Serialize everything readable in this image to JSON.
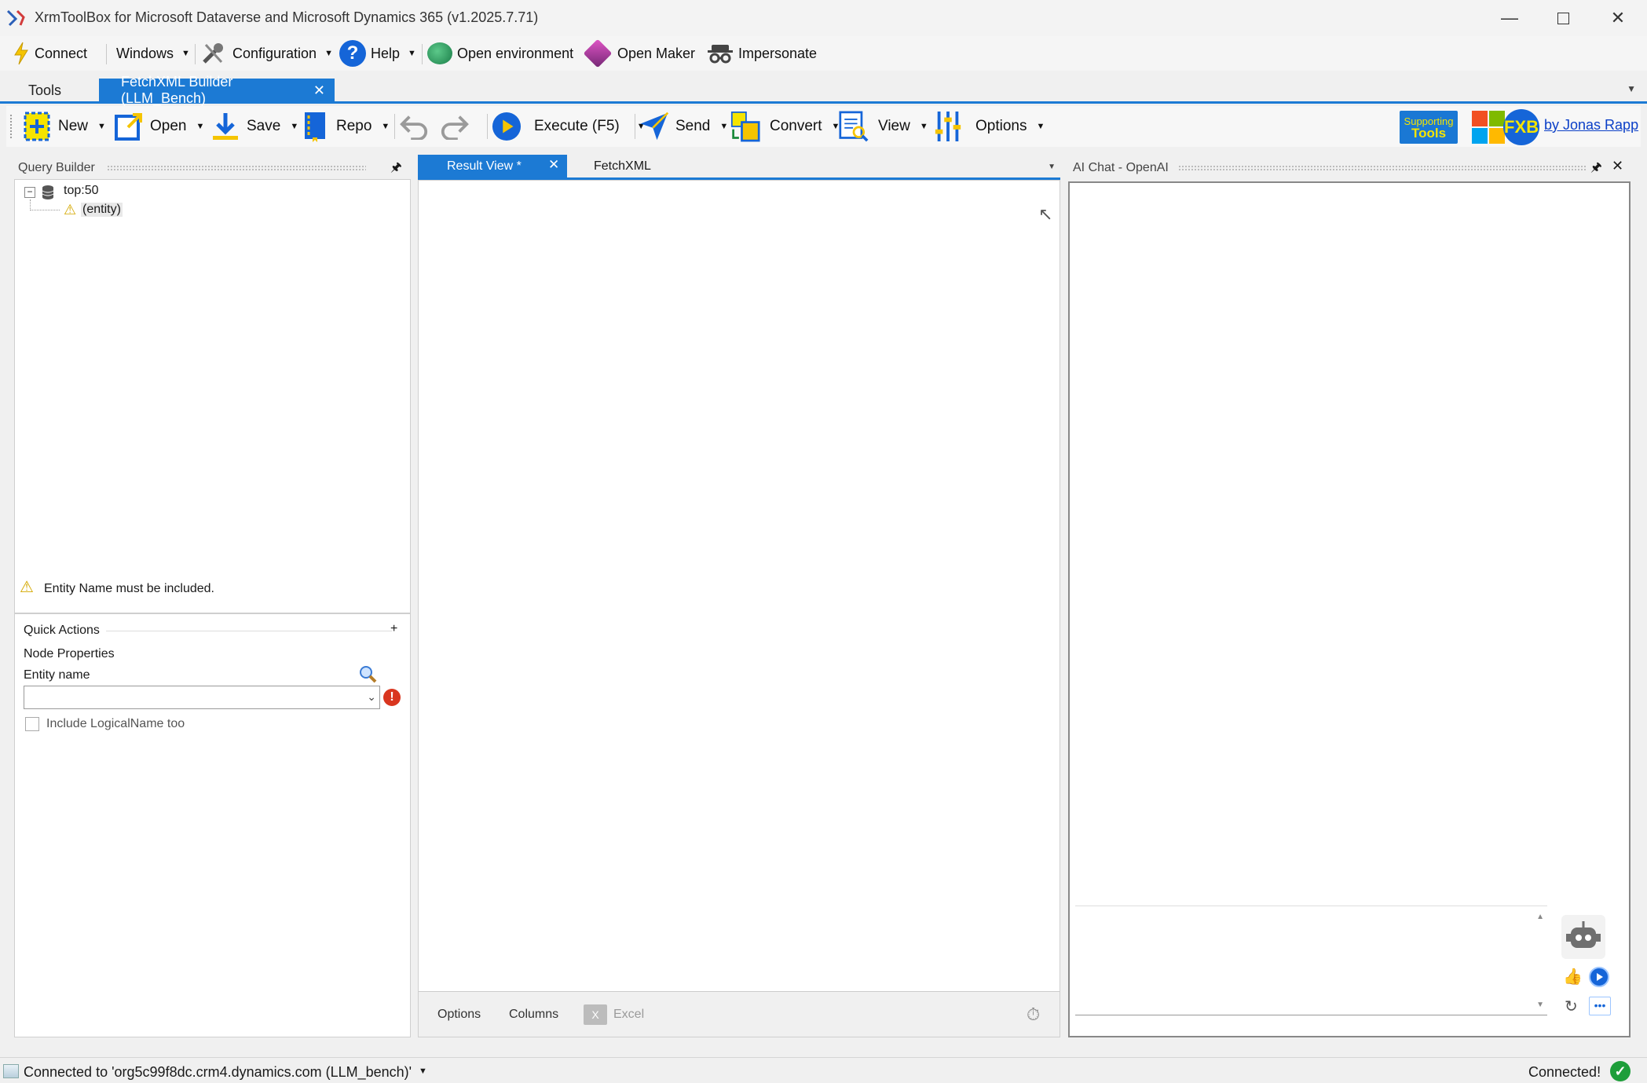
{
  "window": {
    "title": "XrmToolBox for Microsoft Dataverse and Microsoft Dynamics 365 (v1.2025.7.71)"
  },
  "menu": {
    "connect": "Connect",
    "windows": "Windows",
    "configuration": "Configuration",
    "help": "Help",
    "open_environment": "Open environment",
    "open_maker": "Open Maker",
    "impersonate": "Impersonate"
  },
  "doc_tabs": {
    "tools": "Tools",
    "active": "FetchXML Builder (LLM_Bench)"
  },
  "toolbar": {
    "new": "New",
    "open": "Open",
    "save": "Save",
    "repo": "Repo",
    "execute": "Execute (F5)",
    "send": "Send",
    "convert": "Convert",
    "view": "View",
    "options": "Options",
    "supporting_tools_line1": "Supporting",
    "supporting_tools_line2": "Tools",
    "fxb": "FXB",
    "author_link": "by Jonas Rapp"
  },
  "query_builder": {
    "title": "Query Builder",
    "tree_root": "top:50",
    "tree_child": "(entity)",
    "warning": "Entity Name must be included.",
    "quick_actions": "Quick Actions",
    "node_properties": "Node Properties",
    "entity_name_label": "Entity name",
    "entity_name_value": "",
    "include_logical_name": "Include LogicalName too"
  },
  "result": {
    "tab_result": "Result View *",
    "tab_fetchxml": "FetchXML",
    "bottom_options": "Options",
    "bottom_columns": "Columns",
    "bottom_excel": "Excel"
  },
  "ai_chat": {
    "title": "AI Chat - OpenAI",
    "input_value": ""
  },
  "status": {
    "connected_to": "Connected to 'org5c99f8dc.crm4.dynamics.com (LLM_bench)'",
    "connected": "Connected!"
  },
  "colors": {
    "accent": "#1c7ad4",
    "warning": "#f5c400",
    "error": "#d9361f",
    "link": "#0b3fc7"
  }
}
